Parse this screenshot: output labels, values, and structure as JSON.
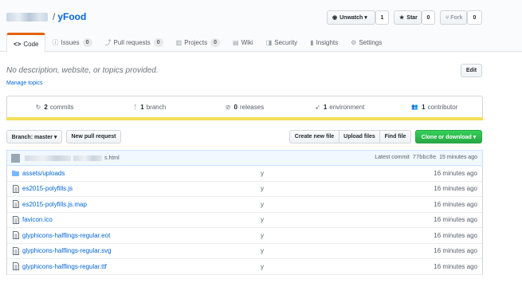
{
  "repo": {
    "separator": "/",
    "name": "yFood"
  },
  "header_buttons": {
    "watch_label": "Unwatch ▾",
    "watch_count": "1",
    "star_label": "Star",
    "star_count": "0",
    "fork_label": "Fork",
    "fork_count": "0"
  },
  "tabs": [
    {
      "icon": "code-icon",
      "glyph": "<>",
      "label": "Code",
      "count": ""
    },
    {
      "icon": "issue-icon",
      "glyph": "ⓘ",
      "label": "Issues",
      "count": "0"
    },
    {
      "icon": "pull-request-icon",
      "glyph": "⤴",
      "label": "Pull requests",
      "count": "0"
    },
    {
      "icon": "project-icon",
      "glyph": "▥",
      "label": "Projects",
      "count": "0"
    },
    {
      "icon": "wiki-icon",
      "glyph": "▤",
      "label": "Wiki",
      "count": ""
    },
    {
      "icon": "shield-icon",
      "glyph": "◨",
      "label": "Security",
      "count": ""
    },
    {
      "icon": "graph-icon",
      "glyph": "▮",
      "label": "Insights",
      "count": ""
    },
    {
      "icon": "gear-icon",
      "glyph": "⚙",
      "label": "Settings",
      "count": ""
    }
  ],
  "description": "No description, website, or topics provided.",
  "manage_topics": "Manage topics",
  "edit_label": "Edit",
  "summary": [
    {
      "icon": "history-icon",
      "glyph": "↻",
      "count": "2",
      "label": "commits"
    },
    {
      "icon": "branch-icon",
      "glyph": "ᚴ",
      "count": "1",
      "label": "branch"
    },
    {
      "icon": "tag-icon",
      "glyph": "⊘",
      "count": "0",
      "label": "releases"
    },
    {
      "icon": "rocket-icon",
      "glyph": "➶",
      "count": "1",
      "label": "environment"
    },
    {
      "icon": "people-icon",
      "glyph": "👥",
      "count": "1",
      "label": "contributor"
    }
  ],
  "toolbar": {
    "branch_label": "Branch: master ▾",
    "new_pr": "New pull request",
    "create_file": "Create new file",
    "upload_files": "Upload files",
    "find_file": "Find file",
    "clone": "Clone or download ▾"
  },
  "latest_commit": {
    "message_suffix": "s.html",
    "prefix": "Latest commit",
    "sha": "77bbc8e",
    "age": "15 minutes ago"
  },
  "files": [
    {
      "type": "folder",
      "name": "assets/uploads",
      "message": "y",
      "age": "16 minutes ago"
    },
    {
      "type": "file",
      "name": "es2015-polyfills.js",
      "message": "y",
      "age": "16 minutes ago"
    },
    {
      "type": "file",
      "name": "es2015-polyfills.js.map",
      "message": "y",
      "age": "16 minutes ago"
    },
    {
      "type": "file",
      "name": "favicon.ico",
      "message": "y",
      "age": "16 minutes ago"
    },
    {
      "type": "file",
      "name": "glyphicons-halflings-regular.eot",
      "message": "y",
      "age": "16 minutes ago"
    },
    {
      "type": "file",
      "name": "glyphicons-halflings-regular.svg",
      "message": "y",
      "age": "16 minutes ago"
    },
    {
      "type": "file",
      "name": "glyphicons-halflings-regular.ttf",
      "message": "y",
      "age": "16 minutes ago"
    }
  ],
  "colors": {
    "accent": "#0366d6",
    "tab_active": "#e36209",
    "language_bar": "#f1e05a",
    "clone_button": "#28a745"
  }
}
